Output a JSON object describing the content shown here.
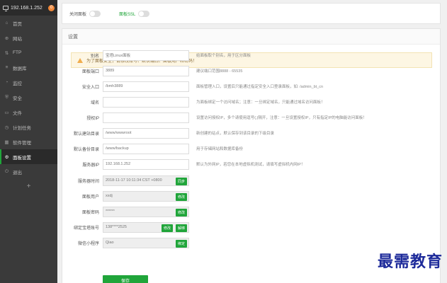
{
  "sidebar": {
    "host": "192.168.1.252",
    "badge": "0",
    "items": [
      {
        "icon": "⌂",
        "label": "首页"
      },
      {
        "icon": "⊕",
        "label": "网站"
      },
      {
        "icon": "⇅",
        "label": "FTP"
      },
      {
        "icon": "≡",
        "label": "数据库"
      },
      {
        "icon": "◔",
        "label": "监控"
      },
      {
        "icon": "⛨",
        "label": "安全"
      },
      {
        "icon": "▭",
        "label": "文件"
      },
      {
        "icon": "◷",
        "label": "计划任务"
      },
      {
        "icon": "▦",
        "label": "软件管理"
      },
      {
        "icon": "⚙",
        "label": "面板设置"
      },
      {
        "icon": "⏻",
        "label": "退出"
      }
    ],
    "add": "+"
  },
  "topbar": {
    "toggle1_label": "关闭面板",
    "toggle2_label": "面板SSL"
  },
  "settings": {
    "title": "设置",
    "notice": "为了面板安全，请修改账号、默认端口、面板用户和密码！",
    "rows": [
      {
        "label": "别名",
        "value": "宝塔Linux面板",
        "hint": "给面板取个别名，用于区分面板"
      },
      {
        "label": "面板端口",
        "value": "3889",
        "hint": "建议端口范围8888 - 65535"
      },
      {
        "label": "安全入口",
        "value": "/bmh3889",
        "hint": "面板管理入口，设置后只能通过指定安全入口登录面板，如: /admin_bt_cn"
      },
      {
        "label": "域名",
        "value": "",
        "hint": "为面板绑定一个访问域名；注意：一旦绑定域名，只能通过域名访问面板！"
      },
      {
        "label": "授权IP",
        "value": "",
        "hint": "设置访问授权IP，多个请使用逗号(,)隔开，注意：一旦设置授权IP，只有指定IP的电脑能访问面板！"
      },
      {
        "label": "默认建站目录",
        "value": "/www/wwwroot",
        "hint": "新创建的站点，默认保存到该目录的下级目录"
      },
      {
        "label": "默认备份目录",
        "value": "/www/backup",
        "hint": "用于存储网站和数据库备份"
      },
      {
        "label": "服务器IP",
        "value": "192.168.1.252",
        "hint": "默认为外网IP，若您在本地虚拟机测试，请填写虚拟机内网IP！"
      },
      {
        "label": "服务器时间",
        "value": "2018-11-17 10:11:34 CST +0800",
        "button": "同步"
      },
      {
        "label": "面板用户",
        "value": "xxdj",
        "button": "修改"
      },
      {
        "label": "面板密码",
        "value": "******",
        "button": "修改"
      },
      {
        "label": "绑定宝塔账号",
        "value": "138****2525",
        "button": "修改",
        "button2": "解绑"
      },
      {
        "label": "微信小程序",
        "value": "Qiao",
        "button": "绑定"
      }
    ],
    "save": "保存"
  },
  "watermark": "最需教育"
}
